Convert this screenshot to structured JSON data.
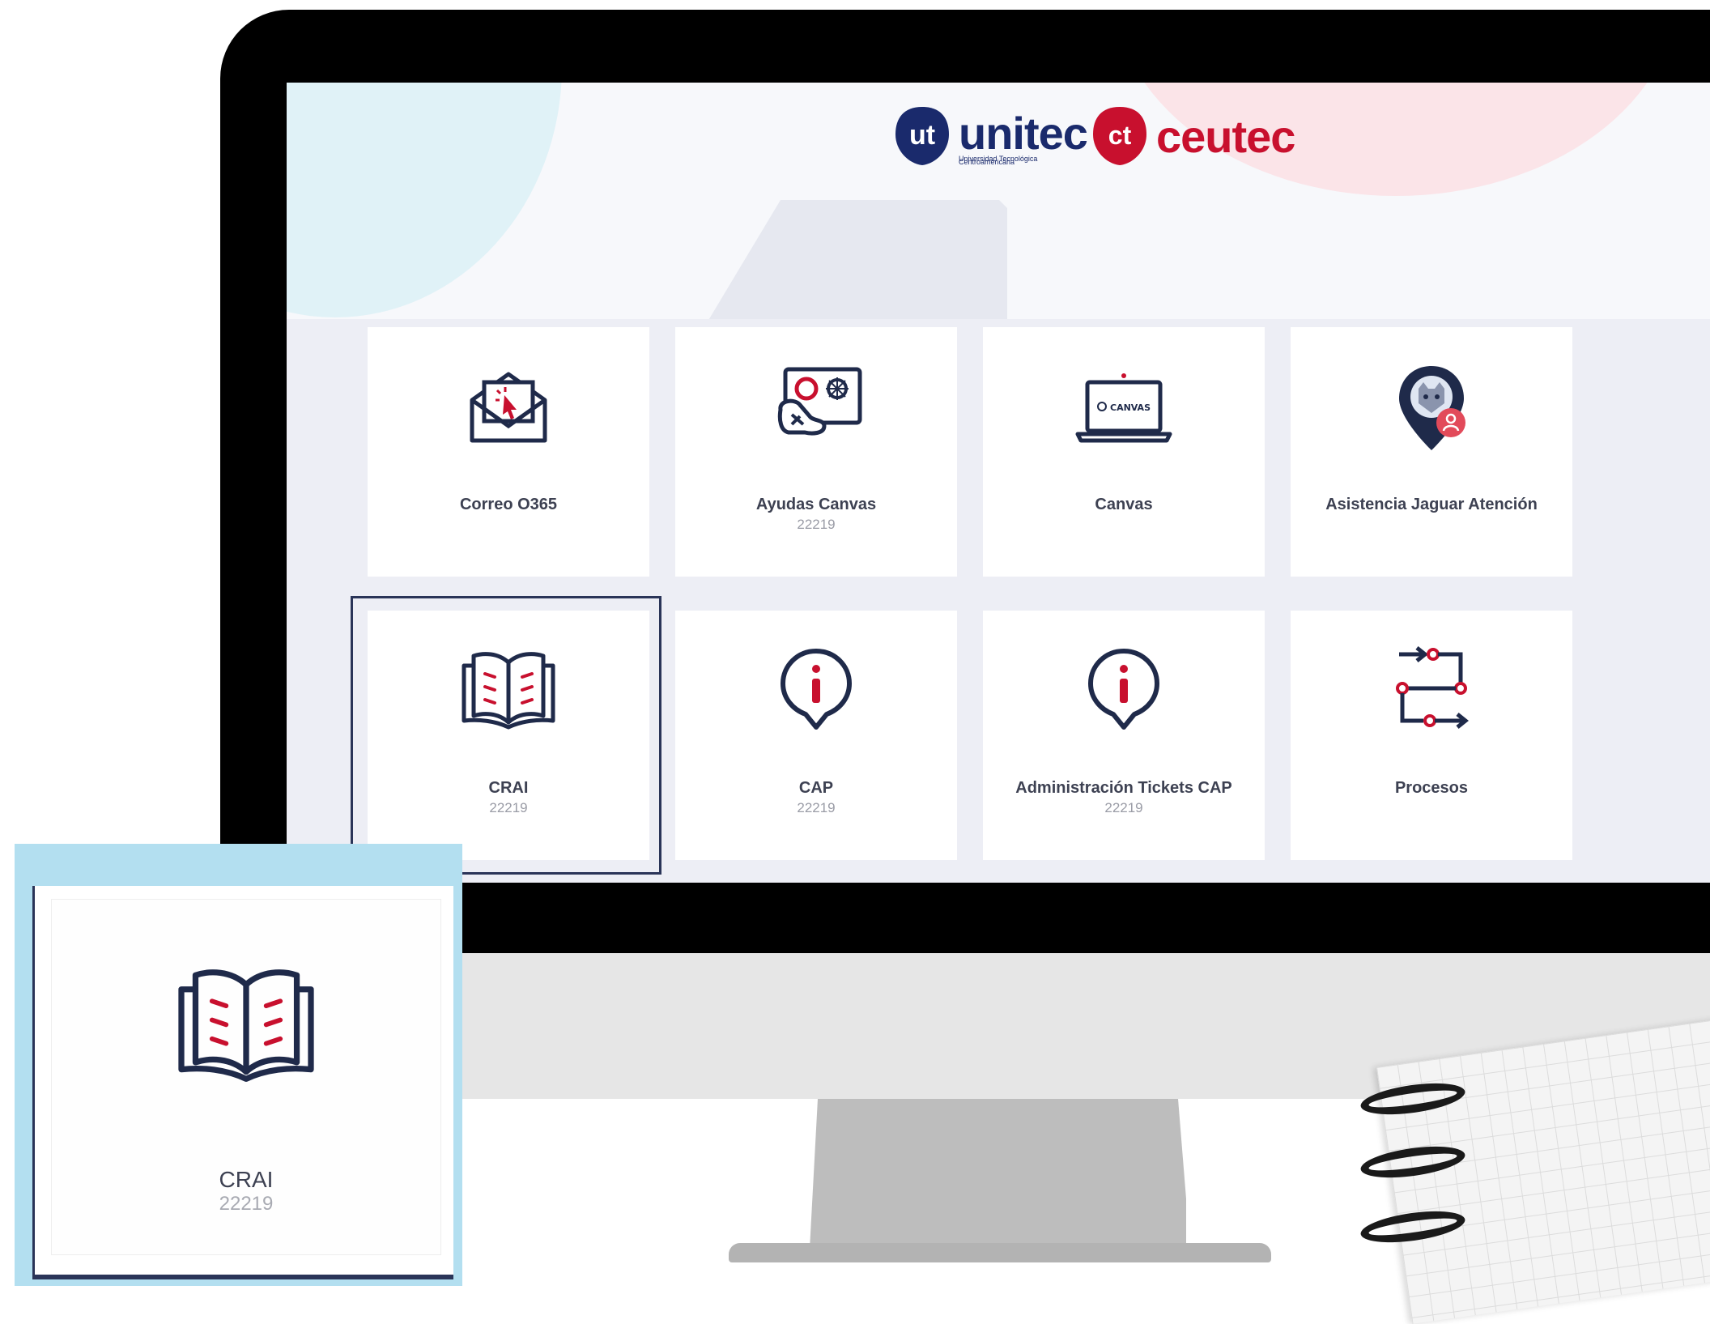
{
  "header": {
    "logo_unitec": "unitec",
    "logo_unitec_badge": "ut",
    "logo_unitec_subtitle_1": "Universidad Tecnológica",
    "logo_unitec_subtitle_2": "Centroamericana",
    "logo_ceutec": "ceutec",
    "logo_ceutec_badge": "ct"
  },
  "tiles": [
    {
      "label": "Correo O365",
      "sub": "",
      "icon": "envelope-cursor-icon"
    },
    {
      "label": "Ayudas Canvas",
      "sub": "22219",
      "icon": "canvas-help-icon"
    },
    {
      "label": "Canvas",
      "sub": "",
      "icon": "laptop-icon"
    },
    {
      "label": "Asistencia Jaguar Atención",
      "sub": "",
      "icon": "jaguar-location-pin-icon"
    },
    {
      "label": "CRAI",
      "sub": "22219",
      "icon": "open-book-icon"
    },
    {
      "label": "CAP",
      "sub": "22219",
      "icon": "info-pin-icon"
    },
    {
      "label": "Administración Tickets CAP",
      "sub": "22219",
      "icon": "info-pin-icon"
    },
    {
      "label": "Procesos",
      "sub": "",
      "icon": "process-flow-icon"
    }
  ],
  "canvas_screen_text": "CANVAS",
  "callout": {
    "label": "CRAI",
    "sub": "22219"
  },
  "colors": {
    "navy": "#1a2a6c",
    "red": "#c8102e",
    "icon_dark": "#1f2a4a",
    "callout_bg": "#b3dff0"
  }
}
